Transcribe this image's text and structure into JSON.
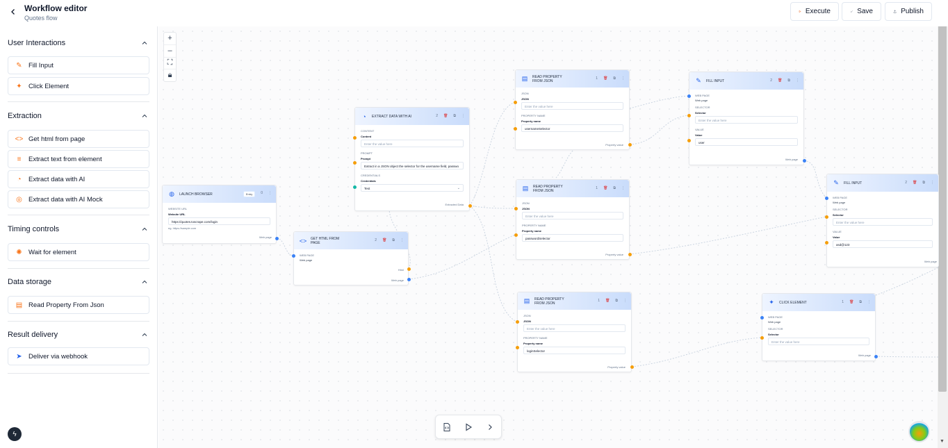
{
  "header": {
    "title": "Workflow editor",
    "subtitle": "Quotes flow",
    "execute_label": "Execute",
    "save_label": "Save",
    "publish_label": "Publish"
  },
  "sidebar": {
    "sections": [
      {
        "title": "User Interactions",
        "items": [
          {
            "label": "Fill Input",
            "icon": "pencil-icon"
          },
          {
            "label": "Click Element",
            "icon": "click-icon"
          }
        ]
      },
      {
        "title": "Extraction",
        "items": [
          {
            "label": "Get html from page",
            "icon": "code-icon"
          },
          {
            "label": "Extract text from element",
            "icon": "text-icon"
          },
          {
            "label": "Extract data with AI",
            "icon": "ai-icon"
          },
          {
            "label": "Extract data with AI Mock",
            "icon": "ai-mock-icon"
          }
        ]
      },
      {
        "title": "Timing controls",
        "items": [
          {
            "label": "Wait for element",
            "icon": "spinner-icon"
          }
        ]
      },
      {
        "title": "Data storage",
        "items": [
          {
            "label": "Read Property From Json",
            "icon": "file-json-icon"
          }
        ]
      },
      {
        "title": "Result delivery",
        "items": [
          {
            "label": "Deliver via webhook",
            "icon": "send-icon"
          }
        ]
      }
    ]
  },
  "nodes": {
    "launch": {
      "title": "LAUNCH BROWSER",
      "badge": "Entry",
      "count": "0",
      "section": "WEBSITE URL",
      "label": "Website URL",
      "value": "https://quotes.toscrape.com/login",
      "hint": "eg. https://sample.com",
      "output": "Web page"
    },
    "gethtml": {
      "title": "GET HTML FROM PAGE",
      "count": "2",
      "section": "WEB PAGE",
      "plain": "Web page",
      "out1": "Html",
      "out2": "Web page"
    },
    "extractai": {
      "title": "EXTRACT DATA WITH AI",
      "count": "2",
      "sec1": "CONTENT",
      "lbl1": "Content",
      "ph1": "Enter the value here",
      "sec2": "PROMPT",
      "lbl2": "Prompt",
      "val2": "Extract in a JSON object the selector for the username field, passwo",
      "sec3": "CREDENTIALS",
      "lbl3": "Credentials",
      "val3": "Test",
      "output": "Extracted Data"
    },
    "read1": {
      "title": "READ PROPERTY FROM JSON",
      "count": "1",
      "sec1": "JSON",
      "lbl1": "JSON",
      "ph1": "Enter the value here",
      "sec2": "PROPERTY NAME",
      "lbl2": "Property name",
      "val2": "usernameSelector",
      "output": "Property value"
    },
    "read2": {
      "title": "READ PROPERTY FROM JSON",
      "count": "1",
      "sec1": "JSON",
      "lbl1": "JSON",
      "ph1": "Enter the value here",
      "sec2": "PROPERTY NAME",
      "lbl2": "Property name",
      "val2": "passwordSelector",
      "output": "Property value"
    },
    "read3": {
      "title": "READ PROPERTY FROM JSON",
      "count": "1",
      "sec1": "JSON",
      "lbl1": "JSON",
      "ph1": "Enter the value here",
      "sec2": "PROPERTY NAME",
      "lbl2": "Property name",
      "val2": "loginSelector",
      "output": "Property value"
    },
    "fill1": {
      "title": "FILL INPUT",
      "count": "2",
      "sec1": "WEB PAGE",
      "plain1": "Web page",
      "sec2": "SELECTOR",
      "lbl2": "Selector",
      "ph2": "Enter the value here",
      "sec3": "VALUE",
      "lbl3": "Value",
      "val3": "user",
      "output": "Web page"
    },
    "fill2": {
      "title": "FILL INPUT",
      "count": "2",
      "sec1": "WEB PAGE",
      "plain1": "Web page",
      "sec2": "SELECTOR",
      "lbl2": "Selector",
      "ph2": "Enter the value here",
      "sec3": "VALUE",
      "lbl3": "Value",
      "val3": "asd@123",
      "output": "Web page"
    },
    "click": {
      "title": "CLICK ELEMENT",
      "count": "1",
      "sec1": "WEB PAGE",
      "plain1": "Web page",
      "sec2": "SELECTOR",
      "lbl2": "Selector",
      "ph2": "Enter the value here",
      "output": "Web page"
    }
  },
  "colors": {
    "accent": "#2563eb",
    "handle_orange": "#f59e0b",
    "handle_blue": "#3b82f6",
    "delete": "#dc2626"
  }
}
